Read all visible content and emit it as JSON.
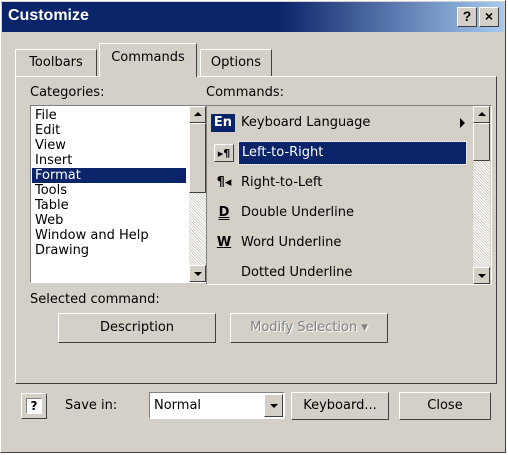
{
  "window": {
    "title": "Customize",
    "help_glyph": "?",
    "close_glyph": "×"
  },
  "tabs": [
    {
      "label": "Toolbars",
      "accel": "b"
    },
    {
      "label": "Commands",
      "accel": "C"
    },
    {
      "label": "Options",
      "accel": "O"
    }
  ],
  "categories": {
    "label": "Categories:",
    "items": [
      "File",
      "Edit",
      "View",
      "Insert",
      "Format",
      "Tools",
      "Table",
      "Web",
      "Window and Help",
      "Drawing"
    ],
    "selected": "Format"
  },
  "commands": {
    "label": "Commands:",
    "items": [
      {
        "icon": "En",
        "icon_name": "keyboard-language-icon",
        "label": "Keyboard Language",
        "has_submenu": true
      },
      {
        "icon": "▸¶",
        "icon_name": "left-to-right-icon",
        "label": "Left-to-Right",
        "selected": true
      },
      {
        "icon": "¶◂",
        "icon_name": "right-to-left-icon",
        "label": "Right-to-Left"
      },
      {
        "icon": "D",
        "icon_name": "double-underline-icon",
        "label": "Double Underline"
      },
      {
        "icon": "W",
        "icon_name": "word-underline-icon",
        "label": "Word Underline"
      },
      {
        "icon": "",
        "icon_name": "dotted-underline-icon",
        "label": "Dotted Underline"
      }
    ]
  },
  "selected_command": {
    "label": "Selected command:",
    "description_button": "Description",
    "modify_button": "Modify Selection ▾"
  },
  "footer": {
    "help_icon": "?",
    "save_in_label": "Save in:",
    "save_in_value": "Normal",
    "keyboard_button": "Keyboard...",
    "close_button": "Close"
  },
  "colors": {
    "titlebar": "#0a246a",
    "face": "#d4d0c8",
    "selection": "#0a246a"
  }
}
